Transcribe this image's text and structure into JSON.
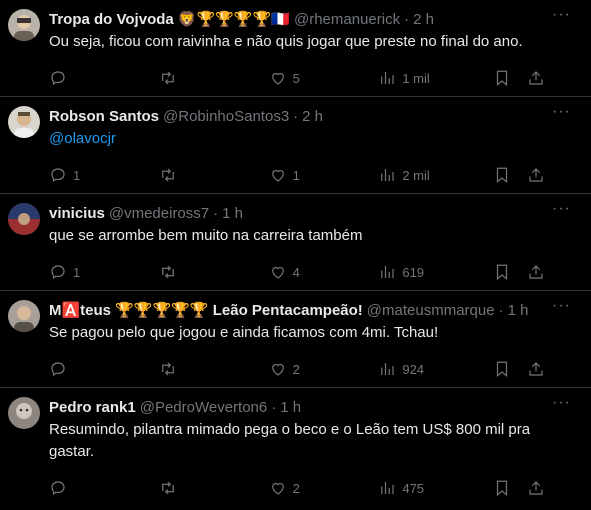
{
  "tweets": [
    {
      "name": "Tropa do Vojvoda 🦁🏆🏆🏆🏆🇫🇷",
      "handle": "@rhemanuerick",
      "time": "2 h",
      "text": "Ou seja, ficou com raivinha e não quis jogar que preste no final do ano.",
      "replies": "",
      "retweets": "",
      "likes": "5",
      "views": "1 mil",
      "avatar_color": "#b8b2a8"
    },
    {
      "name": "Robson Santos",
      "handle": "@RobinhoSantos3",
      "time": "2 h",
      "text": "@olavocjr",
      "replies": "1",
      "retweets": "",
      "likes": "1",
      "views": "2 mil",
      "avatar_color": "#d9d4cc"
    },
    {
      "name": "vinicius",
      "handle": "@vmedeiross7",
      "time": "1 h",
      "text": "que se arrombe bem muito na carreira também",
      "replies": "1",
      "retweets": "",
      "likes": "4",
      "views": "619",
      "avatar_color": "#7a3a3a"
    },
    {
      "name": "M🅰️teus 🏆🏆🏆🏆🏆 Leão Pentacampeão!",
      "handle": "@mateusmmarque",
      "time": "1 h",
      "text": "Se pagou pelo que jogou e ainda ficamos com 4mi. Tchau!",
      "replies": "",
      "retweets": "",
      "likes": "2",
      "views": "924",
      "avatar_color": "#a89f98"
    },
    {
      "name": "Pedro rank1",
      "handle": "@PedroWeverton6",
      "time": "1 h",
      "text": "Resumindo, pilantra mimado pega o beco e o Leão tem US$ 800 mil pra gastar.",
      "replies": "",
      "retweets": "",
      "likes": "2",
      "views": "475",
      "avatar_color": "#8c8580"
    }
  ],
  "icons": {
    "reply": "reply-icon",
    "retweet": "retweet-icon",
    "like": "heart-icon",
    "views": "views-icon",
    "bookmark": "bookmark-icon",
    "share": "share-icon",
    "more": "more-icon"
  }
}
